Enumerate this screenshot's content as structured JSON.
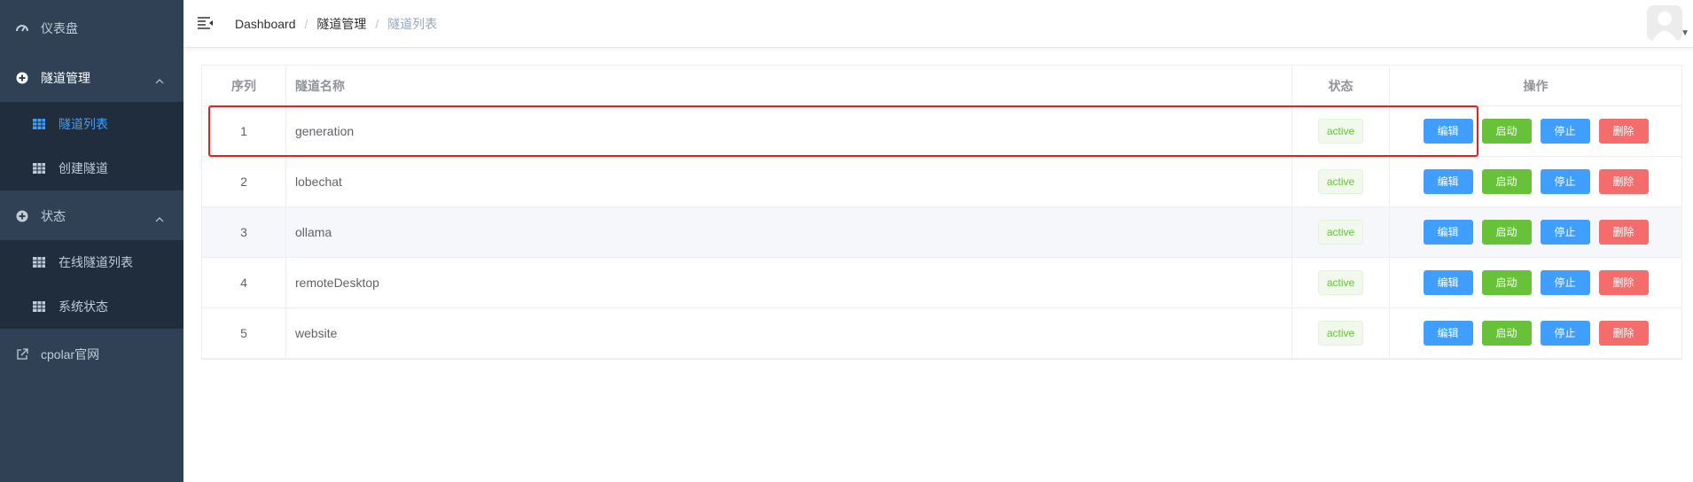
{
  "sidebar": {
    "dashboard": {
      "label": "仪表盘",
      "icon": "dashboard-icon"
    },
    "tunnel_mgmt": {
      "label": "隧道管理",
      "icon": "plus-circle-icon"
    },
    "tunnel_list": {
      "label": "隧道列表",
      "icon": "table-icon"
    },
    "create_tunnel": {
      "label": "创建隧道",
      "icon": "table-icon"
    },
    "status": {
      "label": "状态",
      "icon": "plus-circle-icon"
    },
    "online_tunnels": {
      "label": "在线隧道列表",
      "icon": "table-icon"
    },
    "system_status": {
      "label": "系统状态",
      "icon": "table-icon"
    },
    "cpolar_site": {
      "label": "cpolar官网",
      "icon": "external-link-icon"
    }
  },
  "breadcrumb": [
    "Dashboard",
    "隧道管理",
    "隧道列表"
  ],
  "table": {
    "headers": {
      "index": "序列",
      "name": "隧道名称",
      "status": "状态",
      "ops": "操作"
    },
    "actions": {
      "edit": "编辑",
      "start": "启动",
      "stop": "停止",
      "delete": "删除"
    },
    "rows": [
      {
        "index": "1",
        "name": "generation",
        "status": "active"
      },
      {
        "index": "2",
        "name": "lobechat",
        "status": "active"
      },
      {
        "index": "3",
        "name": "ollama",
        "status": "active"
      },
      {
        "index": "4",
        "name": "remoteDesktop",
        "status": "active"
      },
      {
        "index": "5",
        "name": "website",
        "status": "active"
      }
    ]
  },
  "colors": {
    "sidebar_bg": "#304156",
    "submenu_bg": "#1f2d3d",
    "active": "#409eff",
    "success": "#67c23a",
    "danger": "#f56c6c",
    "highlight": "#e5201f"
  }
}
